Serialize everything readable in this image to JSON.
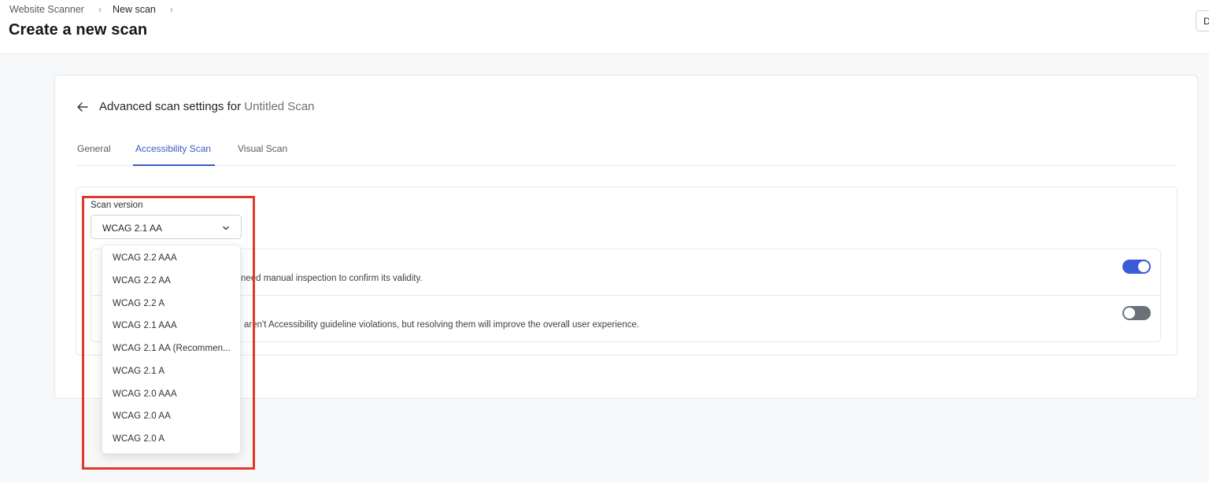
{
  "breadcrumb": {
    "items": [
      {
        "label": "Website Scanner"
      },
      {
        "label": "New scan"
      }
    ],
    "separator": "›"
  },
  "page_title": "Create a new scan",
  "corner_button": {
    "label": "D"
  },
  "settings": {
    "title_prefix": "Advanced scan settings for",
    "scan_name": "Untitled Scan"
  },
  "tabs": [
    {
      "label": "General",
      "active": false
    },
    {
      "label": "Accessibility Scan",
      "active": true
    },
    {
      "label": "Visual Scan",
      "active": false
    }
  ],
  "scan_version": {
    "label": "Scan version",
    "selected": "WCAG 2.1 AA",
    "options": [
      "WCAG 2.2 AAA",
      "WCAG 2.2 AA",
      "WCAG 2.2 A",
      "WCAG 2.1 AAA",
      "WCAG 2.1 AA (Recommen...",
      "WCAG 2.1 A",
      "WCAG 2.0 AAA",
      "WCAG 2.0 AA",
      "WCAG 2.0 A"
    ]
  },
  "options": [
    {
      "description_visible": "need manual inspection to confirm its validity.",
      "enabled": true
    },
    {
      "description_visible": "aren't Accessibility guideline violations, but resolving them will improve the overall user experience.",
      "enabled": false
    }
  ],
  "colors": {
    "accent": "#3b5bc6",
    "toggle_on": "#3b5bd9",
    "toggle_off": "#6b7178",
    "highlight": "#e0382b"
  },
  "icons": {
    "back": "arrow-left-icon",
    "select": "chevron-down-icon",
    "breadcrumb_sep": "chevron-right-icon"
  }
}
